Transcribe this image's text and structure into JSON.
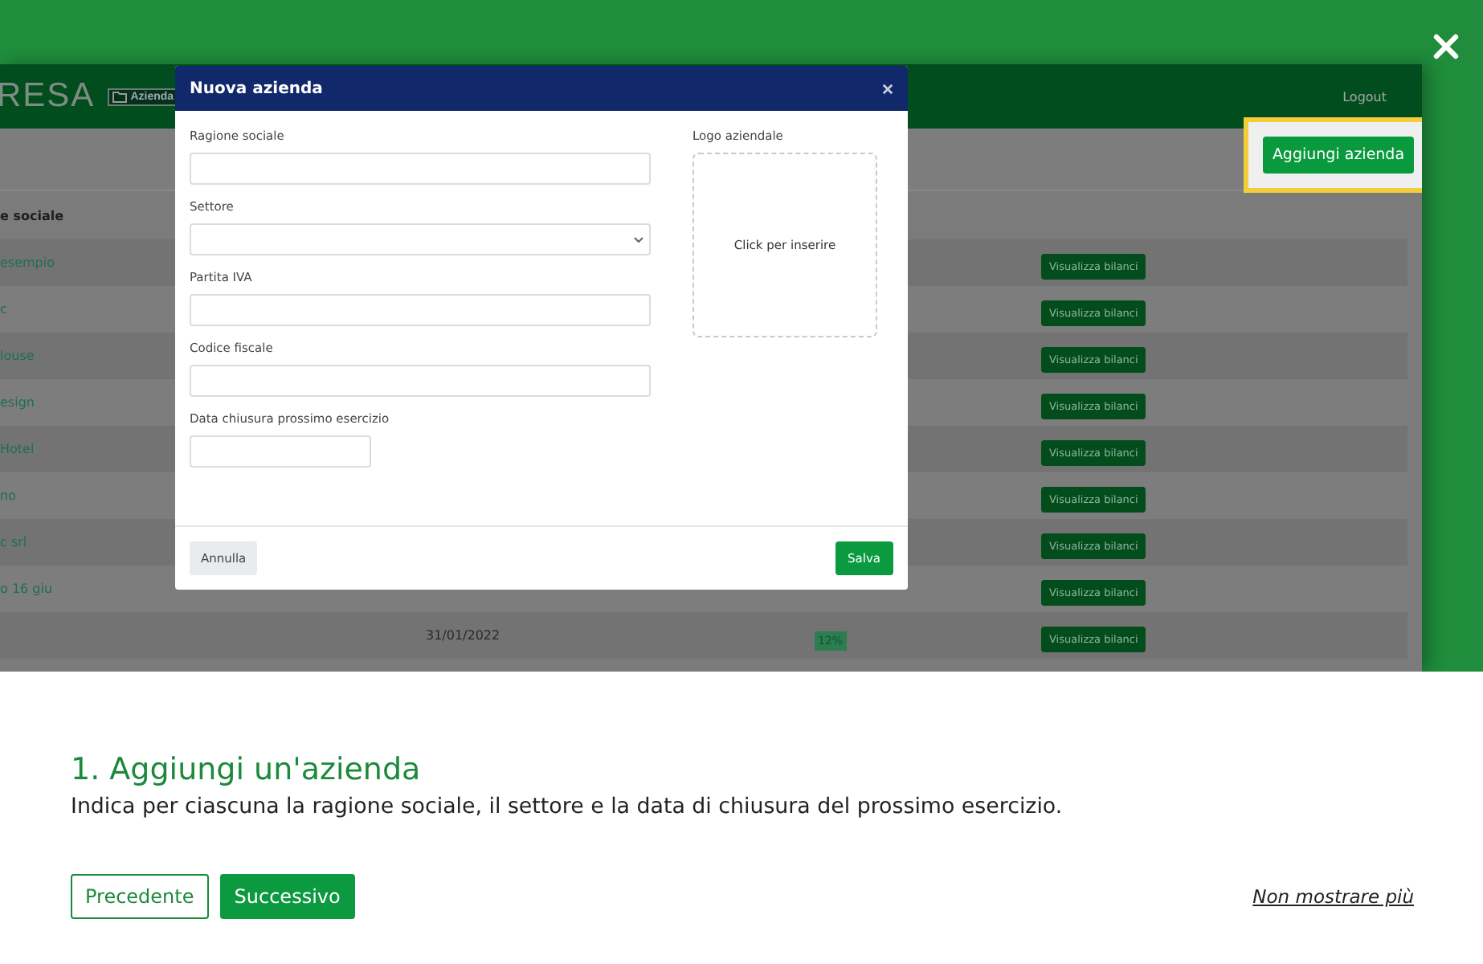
{
  "app": {
    "logo": "RESA",
    "nav_badge": "Azienda",
    "logout": "Logout",
    "add_button": "Aggiungi azienda",
    "table": {
      "header": "e sociale",
      "rows": [
        {
          "name": "esempio",
          "action": "Visualizza bilanci"
        },
        {
          "name": "c",
          "action": "Visualizza bilanci"
        },
        {
          "name": "louse",
          "action": "Visualizza bilanci"
        },
        {
          "name": "esign",
          "action": "Visualizza bilanci"
        },
        {
          "name": "Hotel",
          "action": "Visualizza bilanci"
        },
        {
          "name": "no",
          "action": "Visualizza bilanci"
        },
        {
          "name": "c srl",
          "action": "Visualizza bilanci"
        },
        {
          "name": "o 16 giu",
          "action": "Visualizza bilanci"
        },
        {
          "date": "31/01/2022",
          "badge": "12%",
          "action": "Visualizza bilanci"
        }
      ]
    }
  },
  "modal": {
    "title": "Nuova azienda",
    "fields": [
      {
        "label": "Ragione sociale",
        "kind": "text"
      },
      {
        "label": "Settore",
        "kind": "select"
      },
      {
        "label": "Partita IVA",
        "kind": "text"
      },
      {
        "label": "Codice fiscale",
        "kind": "text"
      },
      {
        "label": "Data chiusura prossimo esercizio",
        "kind": "date"
      }
    ],
    "logo_label": "Logo aziendale",
    "logo_hint": "Click per inserire",
    "cancel": "Annulla",
    "save": "Salva"
  },
  "tour": {
    "title": "1. Aggiungi un'azienda",
    "description": "Indica per ciascuna la ragione sociale, il settore e la data di chiusura del prossimo esercizio.",
    "prev": "Precedente",
    "next": "Successivo",
    "dismiss": "Non mostrare più"
  }
}
